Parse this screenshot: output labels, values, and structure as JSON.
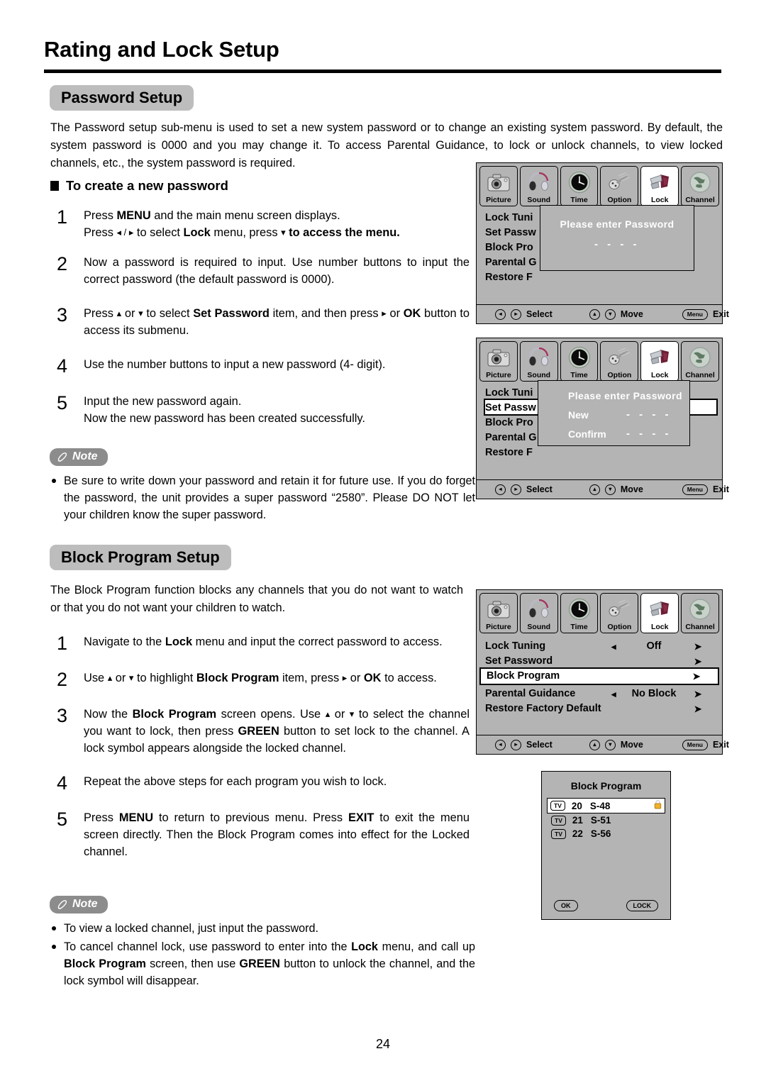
{
  "page": {
    "title": "Rating and Lock Setup",
    "number": "24"
  },
  "sections": {
    "password": {
      "badge": "Password Setup",
      "intro": "The Password setup sub-menu is used to set a new system password or to change an existing system password. By default, the system password is 0000 and you may change it. To access Parental Guidance, to lock or unlock channels, to view locked channels, etc., the system password is required.",
      "subheading": "To create a new password",
      "steps": [
        {
          "num": "1",
          "line1_a": "Press ",
          "line1_b": "MENU",
          "line1_c": " and the main menu screen displays.",
          "line2_a": "Press ",
          "line2_arrows": "◂ / ▸",
          "line2_b": " to select ",
          "line2_c": "Lock",
          "line2_d": " menu,  press ",
          "line2_e": "▾",
          "line2_f": " to access the menu",
          "line2_g": "."
        },
        {
          "num": "2",
          "text": "Now a password is required to input. Use number buttons to input the correct password (the default password is 0000)."
        },
        {
          "num": "3",
          "a": "Press ",
          "up": "▴",
          "b": " or ",
          "down": "▾",
          "c": " to select ",
          "d": "Set Password",
          "e": " item, and then press ",
          "right": "▸",
          "f": " or ",
          "g": "OK",
          "h": " button to access its submenu."
        },
        {
          "num": "4",
          "text": "Use  the number buttons to input a  new password (4- digit)."
        },
        {
          "num": "5",
          "line1": "Input the new password again.",
          "line2": "Now the new password has been created successfully."
        }
      ],
      "note": {
        "label": "Note",
        "items": [
          "Be sure to write down your password and retain it for future use. If you do forget the password, the unit provides a  super password “2580”. Please DO NOT let your children know the super password."
        ]
      }
    },
    "block": {
      "badge": "Block Program Setup",
      "intro": "The Block Program function blocks any channels that you do not want to watch or that you do not want your children to watch.",
      "steps": [
        {
          "num": "1",
          "a": "Navigate to the ",
          "b": "Lock",
          "c": " menu and input the correct password to access."
        },
        {
          "num": "2",
          "a": "Use ",
          "up": "▴",
          "b": " or ",
          "down": "▾",
          "c": " to highlight ",
          "d": "Block Program",
          "e": " item, press ",
          "right": "▸",
          "f": " or  ",
          "g": "OK",
          "h": " to access."
        },
        {
          "num": "3",
          "a": "Now the ",
          "b": "Block Program",
          "c": " screen opens. Use ",
          "up": "▴",
          "d": " or ",
          "down": "▾",
          "e": " to select the channel you want to lock, then press ",
          "f": "GREEN",
          "g": " button to set lock to the channel. A lock symbol appears alongside the locked channel."
        },
        {
          "num": "4",
          "text": "Repeat the above steps for each program you wish to lock."
        },
        {
          "num": "5",
          "a": "Press ",
          "b": "MENU",
          "c": " to return to previous menu. Press ",
          "d": "EXIT",
          "e": " to exit the menu screen directly.  Then the Block  Program comes into effect for the Locked channel."
        }
      ],
      "note": {
        "label": "Note",
        "items": [
          {
            "text": "To view a locked channel, just input the password."
          },
          {
            "a": "To cancel channel lock, use password  to  enter into the ",
            "b": "Lock",
            "c": " menu,  and call  up ",
            "d": "Block  Program",
            "e": " screen, then  use ",
            "f": "GREEN",
            "g": " button to unlock the channel, and the lock symbol will disappear."
          }
        ]
      }
    }
  },
  "osd": {
    "tabs": [
      {
        "label": "Picture",
        "icon": "camera-icon",
        "selected": false
      },
      {
        "label": "Sound",
        "icon": "headphones-icon",
        "selected": false
      },
      {
        "label": "Time",
        "icon": "clock-icon",
        "selected": false
      },
      {
        "label": "Option",
        "icon": "plug-icon",
        "selected": false
      },
      {
        "label": "Lock",
        "icon": "lock-icon",
        "selected": true
      },
      {
        "label": "Channel",
        "icon": "globe-icon",
        "selected": false
      }
    ],
    "tabs_alt_sound_label": "Sound",
    "menu_items": [
      {
        "label": "Lock Tuning",
        "value": "Off",
        "left_arrow": "◂",
        "right_arrow": "➤"
      },
      {
        "label": "Set Password",
        "value": "",
        "left_arrow": "",
        "right_arrow": "➤"
      },
      {
        "label": "Block Program",
        "value": "",
        "left_arrow": "",
        "right_arrow": "➤"
      },
      {
        "label": "Parental Guidance",
        "value": "No Block",
        "left_arrow": "◂",
        "right_arrow": "➤"
      },
      {
        "label": "Restore Factory Default",
        "value": "",
        "left_arrow": "",
        "right_arrow": "➤"
      }
    ],
    "truncated_items": [
      "Lock Tuni",
      "Set Passw",
      "Block Pro",
      "Parental G",
      "Restore F"
    ],
    "footer": {
      "select_label": "Select",
      "move_label": "Move",
      "exit_label": "Exit",
      "menu_button": "Menu",
      "left_glyph": "◂",
      "right_glyph": "▸",
      "up_glyph": "▴",
      "down_glyph": "▾"
    },
    "overlay1": {
      "title": "Please enter Password",
      "dashes": "- - - -"
    },
    "overlay2": {
      "title": "Please enter Password",
      "new_label": "New",
      "new_dashes": "- - - -",
      "confirm_label": "Confirm",
      "confirm_dashes": "- - - -"
    },
    "highlighted_item_screen2": "Set Password",
    "highlighted_item_screen3": "Block Program"
  },
  "block_dialog": {
    "title": "Block Program",
    "rows": [
      {
        "tag": "TV",
        "num": "20",
        "name": "S-48",
        "locked": true,
        "selected": true
      },
      {
        "tag": "TV",
        "num": "21",
        "name": "S-51",
        "locked": false,
        "selected": false
      },
      {
        "tag": "TV",
        "num": "22",
        "name": "S-56",
        "locked": false,
        "selected": false
      }
    ],
    "ok_button": "OK",
    "lock_button": "LOCK"
  },
  "colors": {
    "badge_gray": "#bdbdbd",
    "note_gray": "#8c8c8c",
    "osd_gray": "#b4b4b4",
    "lock_icon_yellow": "#f0b028"
  }
}
